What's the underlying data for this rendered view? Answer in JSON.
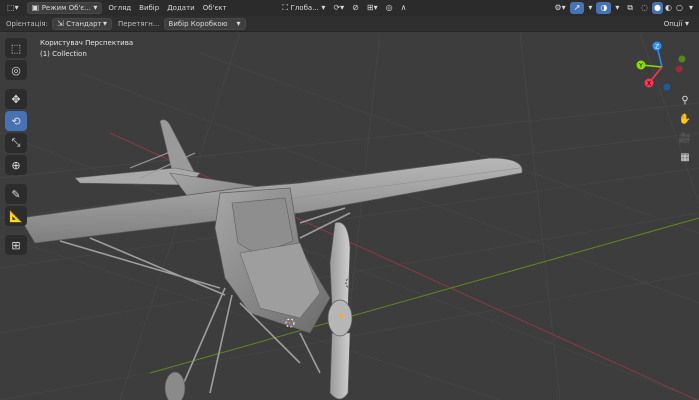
{
  "header": {
    "editor_type_icon": "view3d-icon",
    "mode_label": "Режим Об'є...",
    "menus": [
      "Огляд",
      "Вибір",
      "Додати",
      "Об'єкт"
    ],
    "transform_orientation": "Глоба...",
    "options_label": "Опції"
  },
  "tool_options": {
    "orientation_label": "Орієнтація:",
    "orientation_value": "Стандарт",
    "drag_label": "Перетягн...",
    "drag_value": "Вибір Коробкою"
  },
  "viewport": {
    "view_name": "Користувач Перспектива",
    "collection": "(1) Collection"
  },
  "gizmo": {
    "axes": [
      "X",
      "Y",
      "Z"
    ],
    "colors": {
      "x": "#ff3352",
      "y": "#8bdc00",
      "z": "#2890ff"
    }
  },
  "toolbar": [
    "select-box-icon",
    "cursor-icon",
    "move-icon",
    "rotate-icon",
    "scale-icon",
    "transform-icon",
    "annotate-icon",
    "measure-icon",
    "add-cube-icon"
  ],
  "colors": {
    "accent": "#4772b3",
    "background": "#3d3d3d",
    "header": "#2b2b2b"
  }
}
